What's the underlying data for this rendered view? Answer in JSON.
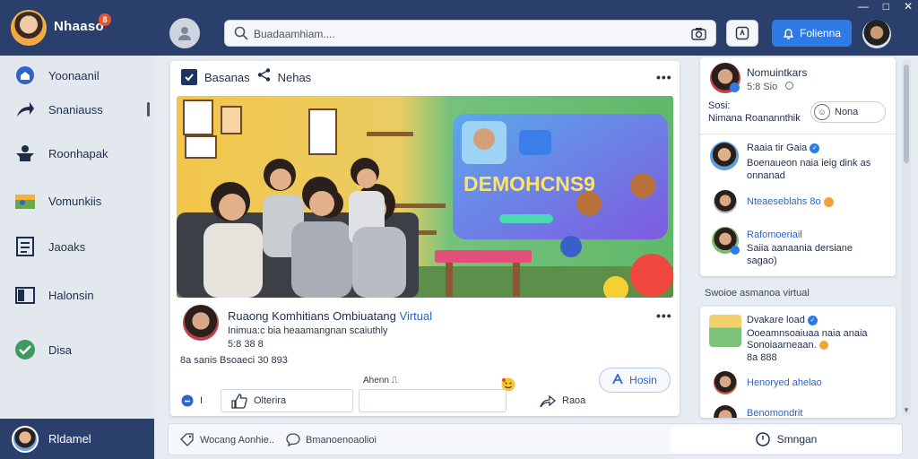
{
  "app": {
    "brand": "Nhaaso",
    "brand_badge": "8"
  },
  "search": {
    "placeholder": "Buadaamhiam...."
  },
  "header": {
    "cta_label": "Folienna"
  },
  "sidebar": {
    "items": [
      {
        "label": "Yoonaanil",
        "icon": "home-icon"
      },
      {
        "label": "Snaniauss",
        "icon": "share-arrow-icon"
      },
      {
        "label": "Roonhapak",
        "icon": "group-icon"
      },
      {
        "label": "Vomunkiis",
        "icon": "game-icon"
      },
      {
        "label": "Jaoaks",
        "icon": "list-icon"
      },
      {
        "label": "Halonsin",
        "icon": "folder-icon"
      },
      {
        "label": "Disa",
        "icon": "check-circle-icon"
      }
    ],
    "profile_label": "Rldamel"
  },
  "post": {
    "header_label": "Basanas",
    "header_link": "Nehas",
    "image_heading": "DEMOHCNS9",
    "title_main": "Ruaong Komhitians Ombiuatang",
    "title_highlight": "Virtual",
    "subtitle": "Inimua:c bia heaamangnan scaiuthly",
    "meta": "5:8 38 8",
    "stats": "8a sanis  Bsoaeci 30 893",
    "mini_label": "Ahenn",
    "follow_label": "Hosin",
    "actions": {
      "count": "I",
      "like_label": "Olterira",
      "share_label": "Raoa"
    }
  },
  "composer": {
    "item1": "Wocang Aonhie..",
    "item2": "Bmanoenoaolioi",
    "submit_label": "Smngan"
  },
  "right": {
    "top_user_name": "Nomuintkars",
    "top_user_meta": "5:8 Sio",
    "top_text_1": "Sosi:",
    "top_text_2": "Nimana Roanannthik",
    "top_pill_label": "Nona",
    "items": [
      {
        "name": "Raaia tir Gaia",
        "line1": "Boenaueon naia ieig dink as",
        "line2": "onnanad"
      },
      {
        "name": "Nteaeseblahs 8o"
      },
      {
        "name": "Rafomoeriail",
        "line1": "Saiia aanaania dersiane",
        "line2": "sagao)"
      }
    ],
    "section_label": "Swoioe asmanoa virtual",
    "bottom_items": [
      {
        "name": "Dvakare load",
        "line1": "Ooeamnsoaiuaa naia anaia",
        "line2": "Sonoiaarneaan.",
        "line3": "8a 888"
      },
      {
        "name": "Henoryed ahelao"
      },
      {
        "name": "Benomondrit"
      }
    ]
  },
  "colors": {
    "topbar": "#2b3f6c",
    "accent": "#2e7be6",
    "link": "#2e64c8"
  }
}
